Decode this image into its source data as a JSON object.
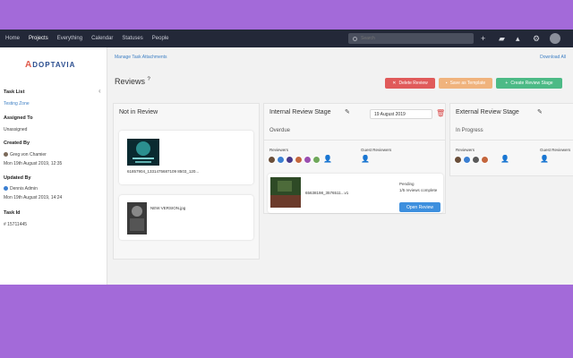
{
  "nav": {
    "items": [
      "Home",
      "Projects",
      "Everything",
      "Calendar",
      "Statuses",
      "People"
    ],
    "search_placeholder": "Search"
  },
  "sidebar": {
    "logo_text": "DOPTAVIA",
    "logo_initial": "A",
    "task_list_label": "Task List",
    "task_list_value": "Testing Zone",
    "assigned_label": "Assigned To",
    "assigned_value": "Unassigned",
    "created_label": "Created By",
    "created_user": "Greg von Chamier",
    "created_date": "Mon 19th August 2019, 12:35",
    "updated_label": "Updated By",
    "updated_user": "Dennis Admin",
    "updated_date": "Mon 19th August 2019, 14:24",
    "taskid_label": "Task Id",
    "taskid_value": "# 15711445"
  },
  "main": {
    "breadcrumb": "Manage Task Attachments",
    "download_all": "Download All",
    "title": "Reviews",
    "buttons": {
      "delete": "Delete Review",
      "template": "Save as Template",
      "create": "Create Review Stage"
    }
  },
  "columns": {
    "not_in_review": {
      "header": "Not in Review",
      "files": [
        {
          "name": "61857904_1331475687109 8503_120..."
        },
        {
          "name": "NEW VERSION.jpg"
        }
      ]
    },
    "internal": {
      "header": "Internal Review Stage",
      "date": "19 August 2019",
      "status": "Overdue",
      "reviewers_label": "Reviewers",
      "guest_label": "Guest Reviewers",
      "file_name": "65638198_3576511...v1",
      "pending": "Pending",
      "complete": "1/5 reviews complete",
      "open_button": "Open Review"
    },
    "external": {
      "header": "External Review Stage",
      "status": "In Progress",
      "reviewers_label": "Reviewers",
      "guest_label": "Guest Reviewers"
    }
  },
  "colors": {
    "nav_bg": "#232838",
    "delete": "#e05a5a",
    "template": "#f0b37d",
    "create": "#4cba86",
    "open": "#3d8fde"
  }
}
